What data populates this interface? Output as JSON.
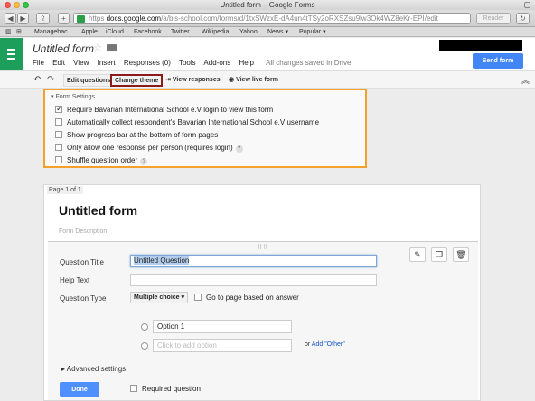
{
  "window": {
    "title": "Untitled form – Google Forms"
  },
  "browser": {
    "url_host": "docs.google.com",
    "url_prefix": "https",
    "url_rest": "/a/bis-school.com/forms/d/1txSWzxE-dA4un4tTSy2oRXSZsu9lw3Ok4WZ8eKr-EPI/edit",
    "reader_label": "Reader",
    "bookmarks": [
      "Managebac",
      "Apple",
      "iCloud",
      "Facebook",
      "Twitter",
      "Wikipedia",
      "Yahoo",
      "News ▾",
      "Popular ▾"
    ]
  },
  "app": {
    "doc_title": "Untitled form",
    "menu": [
      "File",
      "Edit",
      "View",
      "Insert",
      "Responses (0)",
      "Tools",
      "Add-ons",
      "Help"
    ],
    "saved_status": "All changes saved in Drive",
    "send_form_label": "Send form"
  },
  "editor_toolbar": {
    "edit_questions": "Edit questions",
    "change_theme": "Change theme",
    "view_responses": "View responses",
    "view_live_form": "View live form"
  },
  "settings": {
    "header": "▾ Form Settings",
    "options": [
      {
        "label": "Require Bavarian International School e.V login to view this form",
        "checked": true,
        "help": false
      },
      {
        "label": "Automatically collect respondent's Bavarian International School e.V username",
        "checked": false,
        "help": false
      },
      {
        "label": "Show progress bar at the bottom of form pages",
        "checked": false,
        "help": false
      },
      {
        "label": "Only allow one response per person (requires login)",
        "checked": false,
        "help": true
      },
      {
        "label": "Shuffle question order",
        "checked": false,
        "help": true
      }
    ]
  },
  "form": {
    "page_label": "Page 1 of 1",
    "title": "Untitled form",
    "description_placeholder": "Form Description",
    "question": {
      "title_label": "Question Title",
      "title_value": "Untitled Question",
      "help_label": "Help Text",
      "type_label": "Question Type",
      "type_value": "Multiple choice ▾",
      "goto_label": "Go to page based on answer",
      "option1": "Option 1",
      "add_option_placeholder": "Click to add option",
      "or_text": "or",
      "add_other": "Add \"Other\"",
      "advanced": "▸ Advanced settings",
      "done_label": "Done",
      "required_label": "Required question"
    }
  }
}
